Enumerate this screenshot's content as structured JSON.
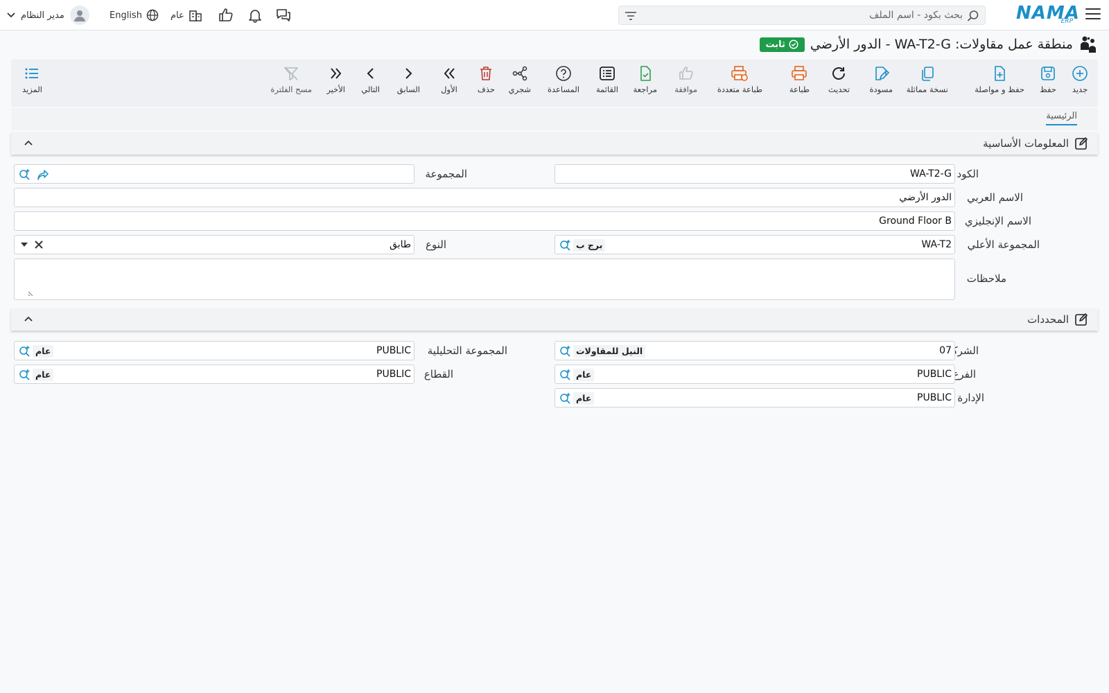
{
  "app": {
    "logo": "NAMA",
    "logo_sub": "ERP",
    "search_placeholder": "بحث بكود - اسم الملف",
    "language": "English",
    "branch": "عام",
    "user": "مدير النظام"
  },
  "page": {
    "title": "منطقة عمل مقاولات: WA-T2-G - الدور الأرضي",
    "status": "ثابت"
  },
  "toolbar": {
    "new": "جديد",
    "save": "حفظ",
    "save_continue": "حفظ و مواصلة",
    "duplicate": "نسخة مماثلة",
    "draft": "مسودة",
    "refresh": "تحديث",
    "print": "طباعة",
    "multi_print": "طباعة متعددة",
    "approve": "موافقة",
    "review": "مراجعة",
    "list": "القائمة",
    "help": "المساعدة",
    "tree": "شجري",
    "delete": "حذف",
    "first": "الأول",
    "previous": "السابق",
    "next": "التالي",
    "last": "الأخير",
    "clear_filter": "مسح الفلترة",
    "more": "المزيد"
  },
  "tabs": {
    "main": "الرئيسية"
  },
  "basic_info": {
    "title": "المعلومات الأساسية",
    "code_label": "الكود",
    "code_value": "WA-T2-G",
    "group_label": "المجموعة",
    "group_value": "",
    "arabic_name_label": "الاسم العربي",
    "arabic_name_value": "الدور الأرضي",
    "english_name_label": "الاسم الإنجليزي",
    "english_name_value": "Ground Floor B",
    "parent_group_label": "المجموعة الأعلي",
    "parent_group_value": "WA-T2",
    "parent_group_tag": "برج ب",
    "type_label": "النوع",
    "type_value": "طابق",
    "notes_label": "ملاحظات",
    "notes_value": ""
  },
  "dimensions": {
    "title": "المحددات",
    "company_label": "الشركة",
    "company_value": "07",
    "company_tag": "النيل للمقاولات",
    "analytic_group_label": "المجموعة التحليلية",
    "analytic_group_value": "PUBLIC",
    "analytic_group_tag": "عام",
    "branch_label": "الفرع",
    "branch_value": "PUBLIC",
    "branch_tag": "عام",
    "sector_label": "القطاع",
    "sector_value": "PUBLIC",
    "sector_tag": "عام",
    "department_label": "الإدارة",
    "department_value": "PUBLIC",
    "department_tag": "عام"
  },
  "colors": {
    "accent": "#1b8fc9",
    "status_green": "#1e9b4b",
    "print_orange": "#e8651a",
    "delete_red": "#c0392b",
    "review_green": "#2e9e4f"
  }
}
